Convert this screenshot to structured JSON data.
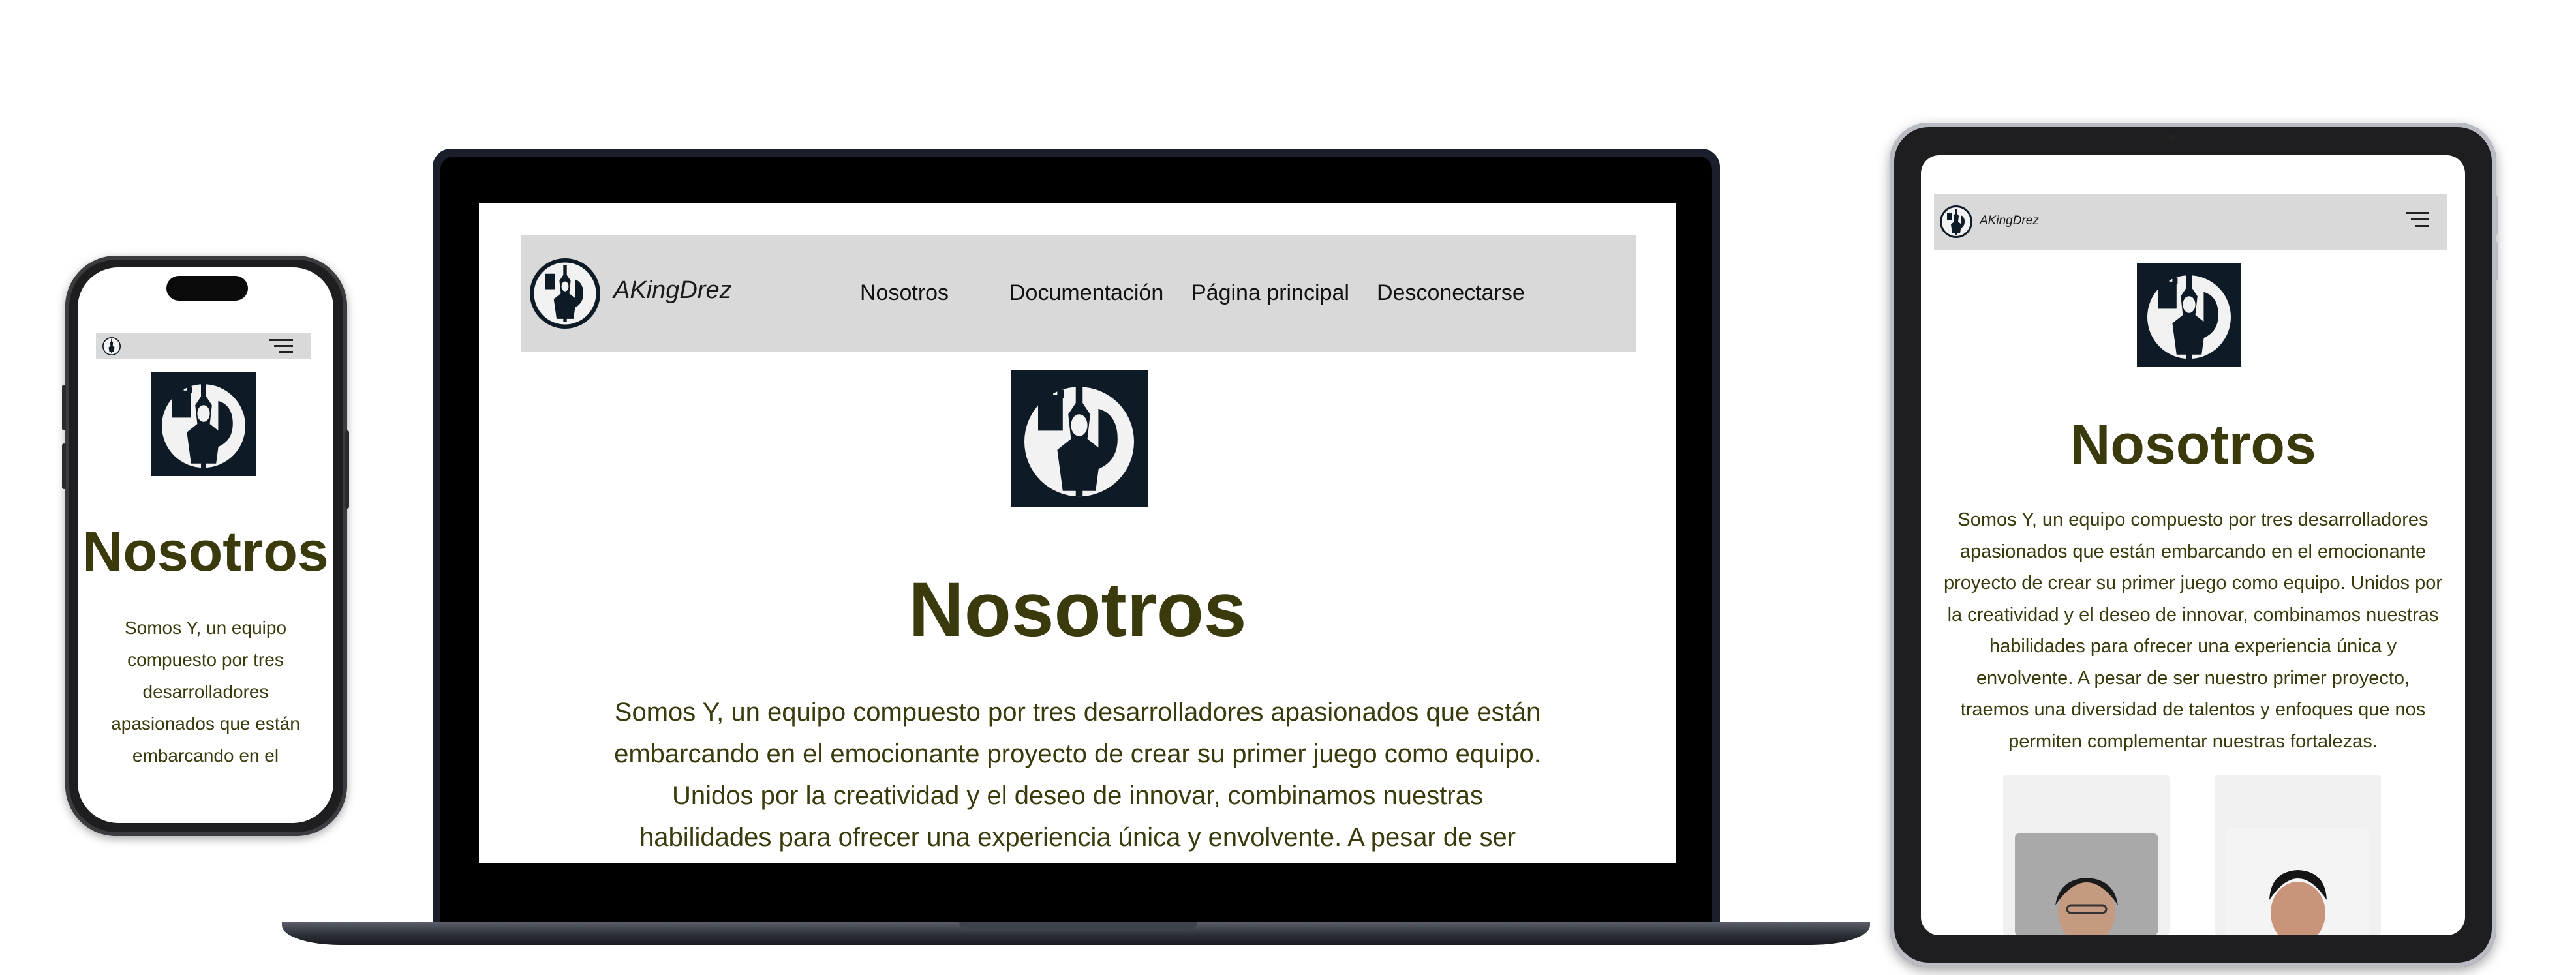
{
  "brand": {
    "name": "AKingDrez"
  },
  "nav": {
    "links": [
      "Nosotros",
      "Documentación",
      "Página principal",
      "Desconectarse"
    ]
  },
  "page": {
    "title": "Nosotros",
    "paragraph": "Somos Y, un equipo compuesto por tres desarrolladores apasionados que están embarcando en el emocionante proyecto de crear su primer juego como equipo. Unidos por la creatividad y el deseo de innovar, combinamos nuestras habilidades para ofrecer una experiencia única y envolvente. A pesar de ser nuestro primer proyecto, traemos una diversidad de talentos y enfoques que nos permiten complementar nuestras fortalezas."
  },
  "colors": {
    "heading": "#3a3a0c",
    "navbar": "#d9d9d9",
    "logo_bg": "#0e1b26"
  },
  "icons": {
    "menu": "hamburger-menu-icon",
    "logo": "knight-logo"
  }
}
